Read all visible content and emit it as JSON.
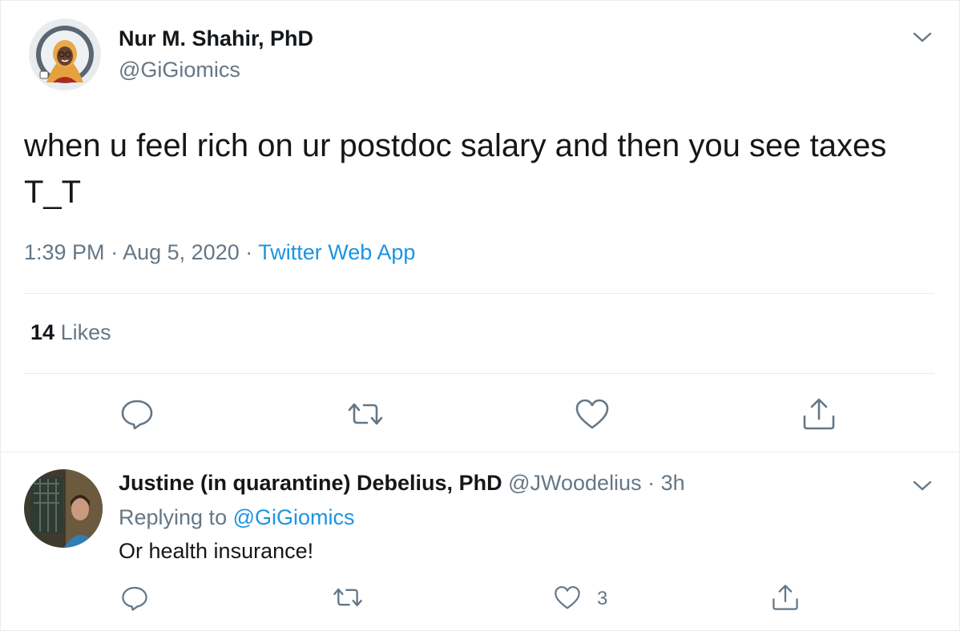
{
  "tweet": {
    "author_name": "Nur M. Shahir, PhD",
    "author_handle": "@GiGiomics",
    "text": "when u feel rich on ur postdoc salary and then you see taxes T_T",
    "time": "1:39 PM",
    "dot1": "·",
    "date": "Aug 5, 2020",
    "dot2": "·",
    "source": "Twitter Web App",
    "likes_count": "14",
    "likes_label": "Likes",
    "actions": [
      "reply-icon",
      "retweet-icon",
      "like-icon",
      "share-icon"
    ]
  },
  "reply": {
    "author_name": "Justine (in quarantine) Debelius, PhD",
    "author_handle": "@JWoodelius",
    "dot": "·",
    "age": "3h",
    "replying_prefix": "Replying to",
    "replying_to": "@GiGiomics",
    "text": "Or health insurance!",
    "like_count": "3",
    "actions": [
      "reply-icon",
      "retweet-icon",
      "like-icon",
      "share-icon"
    ]
  },
  "colors": {
    "text_primary": "#14171a",
    "text_secondary": "#657786",
    "link": "#1b95e0",
    "divider": "#e6ecf0"
  }
}
